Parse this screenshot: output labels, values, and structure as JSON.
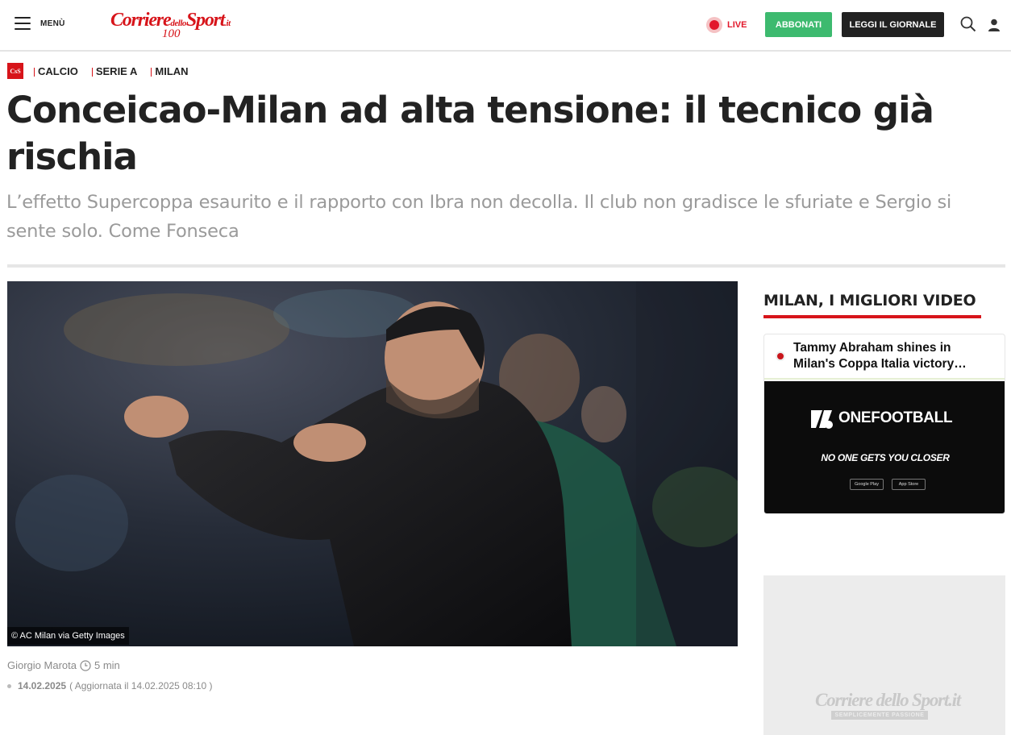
{
  "header": {
    "menu_label": "MENÙ",
    "logo_text": "Corriere",
    "logo_small": "dello",
    "logo_text2": "Sport",
    "logo_suffix": ".it",
    "logo_badge": "100",
    "live_label": "LIVE",
    "subscribe_label": "ABBONATI",
    "newspaper_label": "LEGGI IL GIORNALE",
    "search_icon": "search-icon",
    "user_icon": "user-icon"
  },
  "breadcrumb": {
    "badge": "CsS",
    "items": [
      "CALCIO",
      "SERIE A",
      "MILAN"
    ]
  },
  "article": {
    "headline": "Conceicao-Milan ad alta tensione: il tecnico già rischia",
    "subtitle": "L’effetto Supercoppa esaurito e il rapporto con Ibra non decolla.  Il club non gradisce le sfuriate e Sergio si sente solo. Come Fonseca",
    "image_credit": "© AC Milan via Getty Images",
    "author": "Giorgio Marota",
    "read_time": "5 min",
    "date": "14.02.2025",
    "updated": "( Aggiornata il 14.02.2025 08:10 )"
  },
  "sidebar": {
    "title": "MILAN, I MIGLIORI VIDEO",
    "video_title": "Tammy Abraham shines in Milan's Coppa Italia victory…",
    "brand": "ONEFOOTBALL",
    "tagline": "NO ONE GETS YOU CLOSER",
    "store_google": "Google Play",
    "store_apple": "App Store",
    "ad_logo": "Corriere dello Sport.it",
    "ad_tagline": "SEMPLICEMENTE PASSIONE"
  },
  "colors": {
    "brand_red": "#d7141a",
    "subscribe_green": "#3dba6f",
    "dark_button": "#222222"
  }
}
